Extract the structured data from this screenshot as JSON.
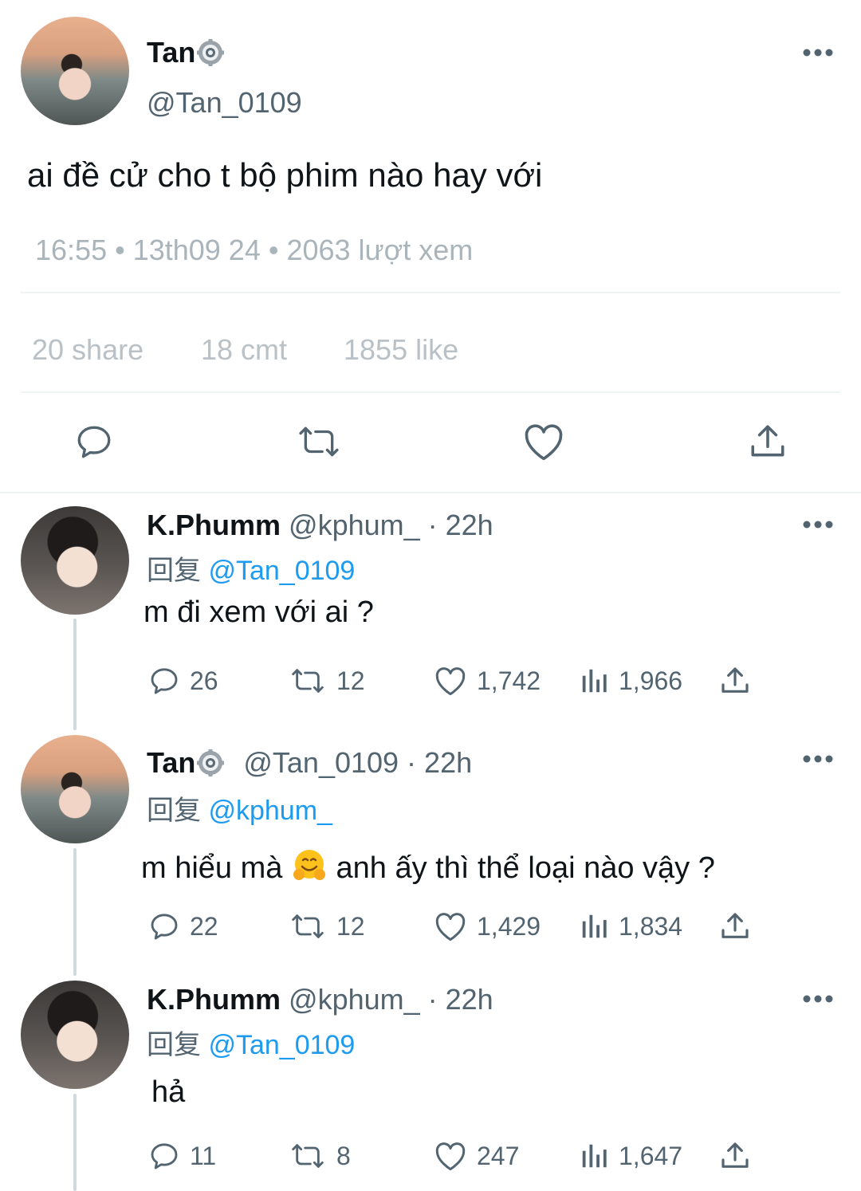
{
  "main_tweet": {
    "author_name": "Tan",
    "author_handle": "@Tan_0109",
    "text": "ai đề cử cho t bộ phim nào hay với",
    "meta": "16:55 • 13th09 24 • 2063 lượt xem",
    "stats": {
      "shares": "20 share",
      "comments": "18 cmt",
      "likes": "1855 like"
    }
  },
  "replies": [
    {
      "author_name": "K.Phumm",
      "handle_time": "@kphum_ · 22h",
      "reply_prefix": "回复",
      "reply_to": "@Tan_0109",
      "text": "m đi xem với ai ?",
      "replies": "26",
      "retweets": "12",
      "likes": "1,742",
      "views": "1,966"
    },
    {
      "author_name": "Tan",
      "handle_time": "@Tan_0109 · 22h",
      "reply_prefix": "回复",
      "reply_to": "@kphum_",
      "text_before": "m hiểu mà",
      "text_after": "anh ấy thì thể loại nào vậy ?",
      "replies": "22",
      "retweets": "12",
      "likes": "1,429",
      "views": "1,834"
    },
    {
      "author_name": "K.Phumm",
      "handle_time": "@kphum_ · 22h",
      "reply_prefix": "回复",
      "reply_to": "@Tan_0109",
      "text": "hả",
      "replies": "11",
      "retweets": "8",
      "likes": "247",
      "views": "1,647"
    }
  ],
  "icons": {
    "more": "more-icon",
    "verified": "gear-badge-icon",
    "reply": "reply-icon",
    "retweet": "retweet-icon",
    "like": "heart-icon",
    "share": "share-icon",
    "views": "views-icon",
    "emoji": "hugging-face-emoji"
  },
  "colors": {
    "text": "#0f1419",
    "muted": "#536471",
    "link": "#1d9bf0",
    "divider": "#eff3f4"
  }
}
